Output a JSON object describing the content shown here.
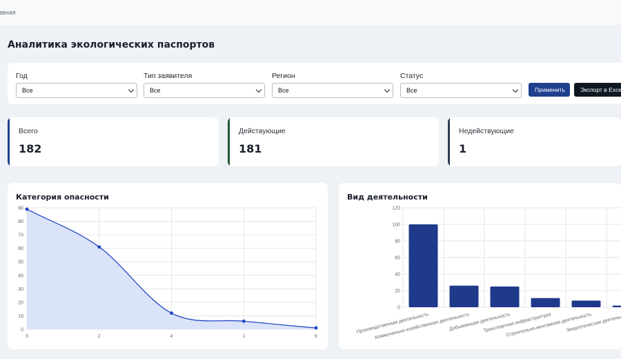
{
  "breadcrumb": "авная",
  "page_title": "Аналитика экологических паспортов",
  "filters": [
    {
      "label": "Год",
      "value": "Все"
    },
    {
      "label": "Тип заявителя",
      "value": "Все"
    },
    {
      "label": "Регион",
      "value": "Все"
    },
    {
      "label": "Статус",
      "value": "Все"
    }
  ],
  "buttons": {
    "apply": "Применить",
    "export": "Экспорт в Excel"
  },
  "kpis": [
    {
      "label": "Всего",
      "value": "182",
      "color": "#1f3f8f"
    },
    {
      "label": "Действующие",
      "value": "181",
      "color": "#1e5631"
    },
    {
      "label": "Недействующие",
      "value": "1",
      "color": "#2b3a4f"
    }
  ],
  "chart_data": [
    {
      "type": "area",
      "title": "Категория опасности",
      "categories": [
        "3",
        "2",
        "4",
        "1",
        "5"
      ],
      "values": [
        89,
        61,
        12,
        6,
        1
      ],
      "ylim": [
        0,
        90
      ],
      "yticks": [
        0,
        10,
        20,
        30,
        40,
        50,
        60,
        70,
        80,
        90
      ],
      "grid": true,
      "color": "#2449c4",
      "fill": "#dbe3f8"
    },
    {
      "type": "bar",
      "title": "Вид деятельности",
      "categories": [
        "Производственная деятельность",
        "Коммунально-хозяйственная деятельность",
        "Добывающая деятельность",
        "Транспортная инфраструктура",
        "Строительно-монтажная деятельность",
        "Энергетическая деятельность"
      ],
      "values": [
        100,
        26,
        25,
        11,
        8,
        2
      ],
      "ylim": [
        0,
        120
      ],
      "yticks": [
        0,
        20,
        40,
        60,
        80,
        100,
        120
      ],
      "grid": true,
      "color": "#1f3a8a"
    }
  ]
}
